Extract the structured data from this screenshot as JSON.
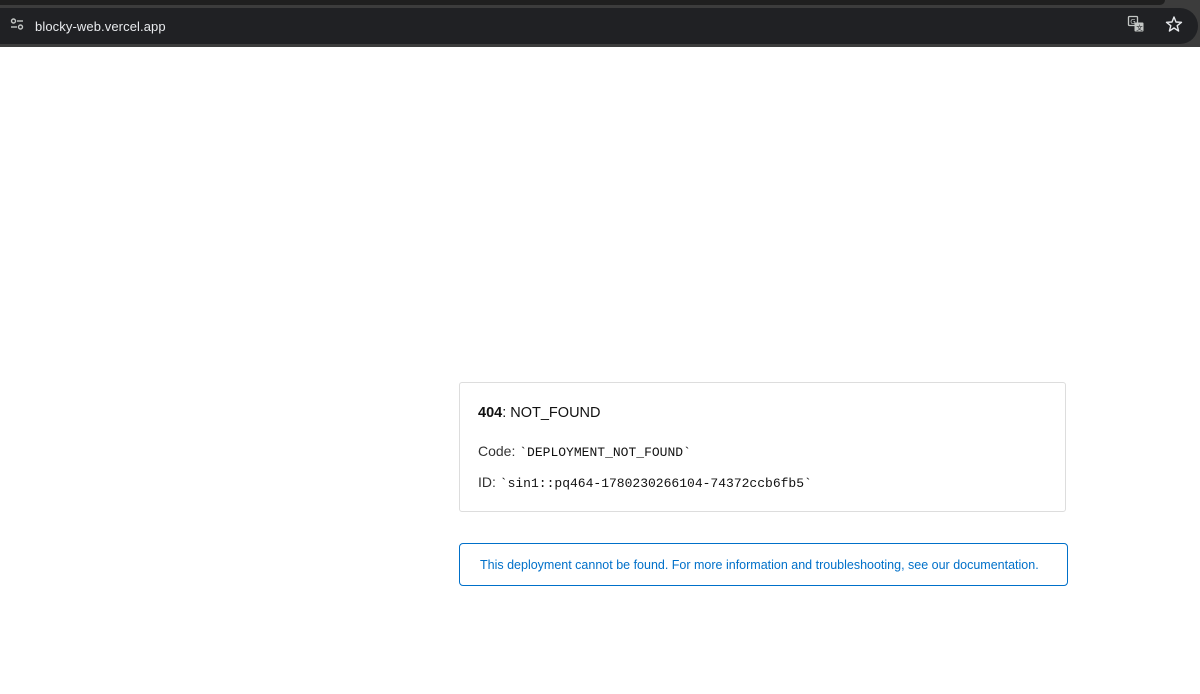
{
  "browser": {
    "url": "blocky-web.vercel.app",
    "icons": {
      "site_info": "tune-icon",
      "translate": "translate-icon",
      "bookmark": "star-icon"
    }
  },
  "error": {
    "status_code": "404",
    "separator": ": ",
    "status_text": "NOT_FOUND",
    "code_label": "Code: ",
    "code_value": "`DEPLOYMENT_NOT_FOUND`",
    "id_label": "ID: ",
    "id_value": "`sin1::pq464-1780230266104-74372ccb6fb5`"
  },
  "info": {
    "message": "This deployment cannot be found. For more information and troubleshooting, see our documentation."
  },
  "colors": {
    "accent": "#0070c9",
    "toolbar": "#202124"
  }
}
